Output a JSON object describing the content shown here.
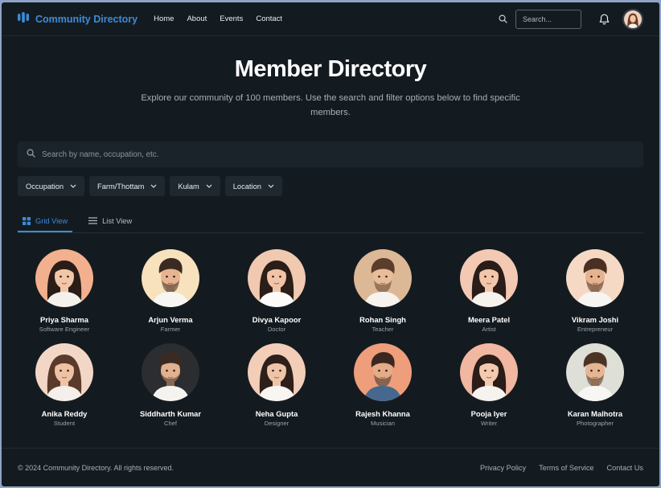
{
  "nav": {
    "brand": "Community Directory",
    "links": [
      "Home",
      "About",
      "Events",
      "Contact"
    ],
    "search_placeholder": "Search..."
  },
  "hero": {
    "title": "Member Directory",
    "subtitle": "Explore our community of 100 members. Use the search and filter options below to find specific members."
  },
  "search": {
    "placeholder": "Search by name, occupation, etc."
  },
  "filters": [
    "Occupation",
    "Farm/Thottam",
    "Kulam",
    "Location"
  ],
  "tabs": {
    "grid": "Grid View",
    "list": "List View",
    "active": "grid"
  },
  "members": [
    {
      "name": "Priya Sharma",
      "occupation": "Software Engineer",
      "bg": "#f2b08e",
      "skin": "#f3c6a8",
      "hair": "#2a1c17",
      "shirt": "#f4f1ec",
      "gender": "f"
    },
    {
      "name": "Arjun Verma",
      "occupation": "Farmer",
      "bg": "#f7e2bd",
      "skin": "#e8b48f",
      "hair": "#3b2a22",
      "shirt": "#f8f6f2",
      "gender": "m"
    },
    {
      "name": "Divya Kapoor",
      "occupation": "Doctor",
      "bg": "#f0c9b0",
      "skin": "#f1c4a6",
      "hair": "#2b1d18",
      "shirt": "#fbfaf8",
      "gender": "f"
    },
    {
      "name": "Rohan Singh",
      "occupation": "Teacher",
      "bg": "#dcb897",
      "skin": "#e9bd99",
      "hair": "#5a3d2c",
      "shirt": "#f6f3ee",
      "gender": "m"
    },
    {
      "name": "Meera Patel",
      "occupation": "Artist",
      "bg": "#f3c9b3",
      "skin": "#f2c6aa",
      "hair": "#2a1d19",
      "shirt": "#f6f2ee",
      "gender": "f"
    },
    {
      "name": "Vikram Joshi",
      "occupation": "Entrepreneur",
      "bg": "#f6d9c4",
      "skin": "#e6b38e",
      "hair": "#4a3023",
      "shirt": "#f7f5f2",
      "gender": "m"
    },
    {
      "name": "Anika Reddy",
      "occupation": "Student",
      "bg": "#f3d7c6",
      "skin": "#f0c2a5",
      "hair": "#5a3a2a",
      "shirt": "#f4efea",
      "gender": "f"
    },
    {
      "name": "Siddharth Kumar",
      "occupation": "Chef",
      "bg": "#2b2d31",
      "skin": "#e2b18f",
      "hair": "#3a2a22",
      "shirt": "#f5f3f0",
      "gender": "m"
    },
    {
      "name": "Neha Gupta",
      "occupation": "Designer",
      "bg": "#f2cdb8",
      "skin": "#f0c4a7",
      "hair": "#2e1f1a",
      "shirt": "#f8f5f2",
      "gender": "f"
    },
    {
      "name": "Rajesh Khanna",
      "occupation": "Musician",
      "bg": "#ee9e7a",
      "skin": "#e4ad87",
      "hair": "#3a2820",
      "shirt": "#46688e",
      "gender": "m"
    },
    {
      "name": "Pooja Iyer",
      "occupation": "Writer",
      "bg": "#f1b7a0",
      "skin": "#f3caae",
      "hair": "#2a1c18",
      "shirt": "#f6f2ee",
      "gender": "f"
    },
    {
      "name": "Karan Malhotra",
      "occupation": "Photographer",
      "bg": "#dedfd7",
      "skin": "#e6b693",
      "hair": "#4b3426",
      "shirt": "#f7f6f3",
      "gender": "m"
    }
  ],
  "footer": {
    "copyright": "© 2024 Community Directory. All rights reserved.",
    "links": [
      "Privacy Policy",
      "Terms of Service",
      "Contact Us"
    ]
  },
  "colors": {
    "accent": "#3d8bd9",
    "background": "#141b20"
  },
  "icons": [
    "logo-icon",
    "search-icon",
    "bell-icon",
    "chevron-down-icon",
    "grid-icon",
    "list-icon"
  ]
}
